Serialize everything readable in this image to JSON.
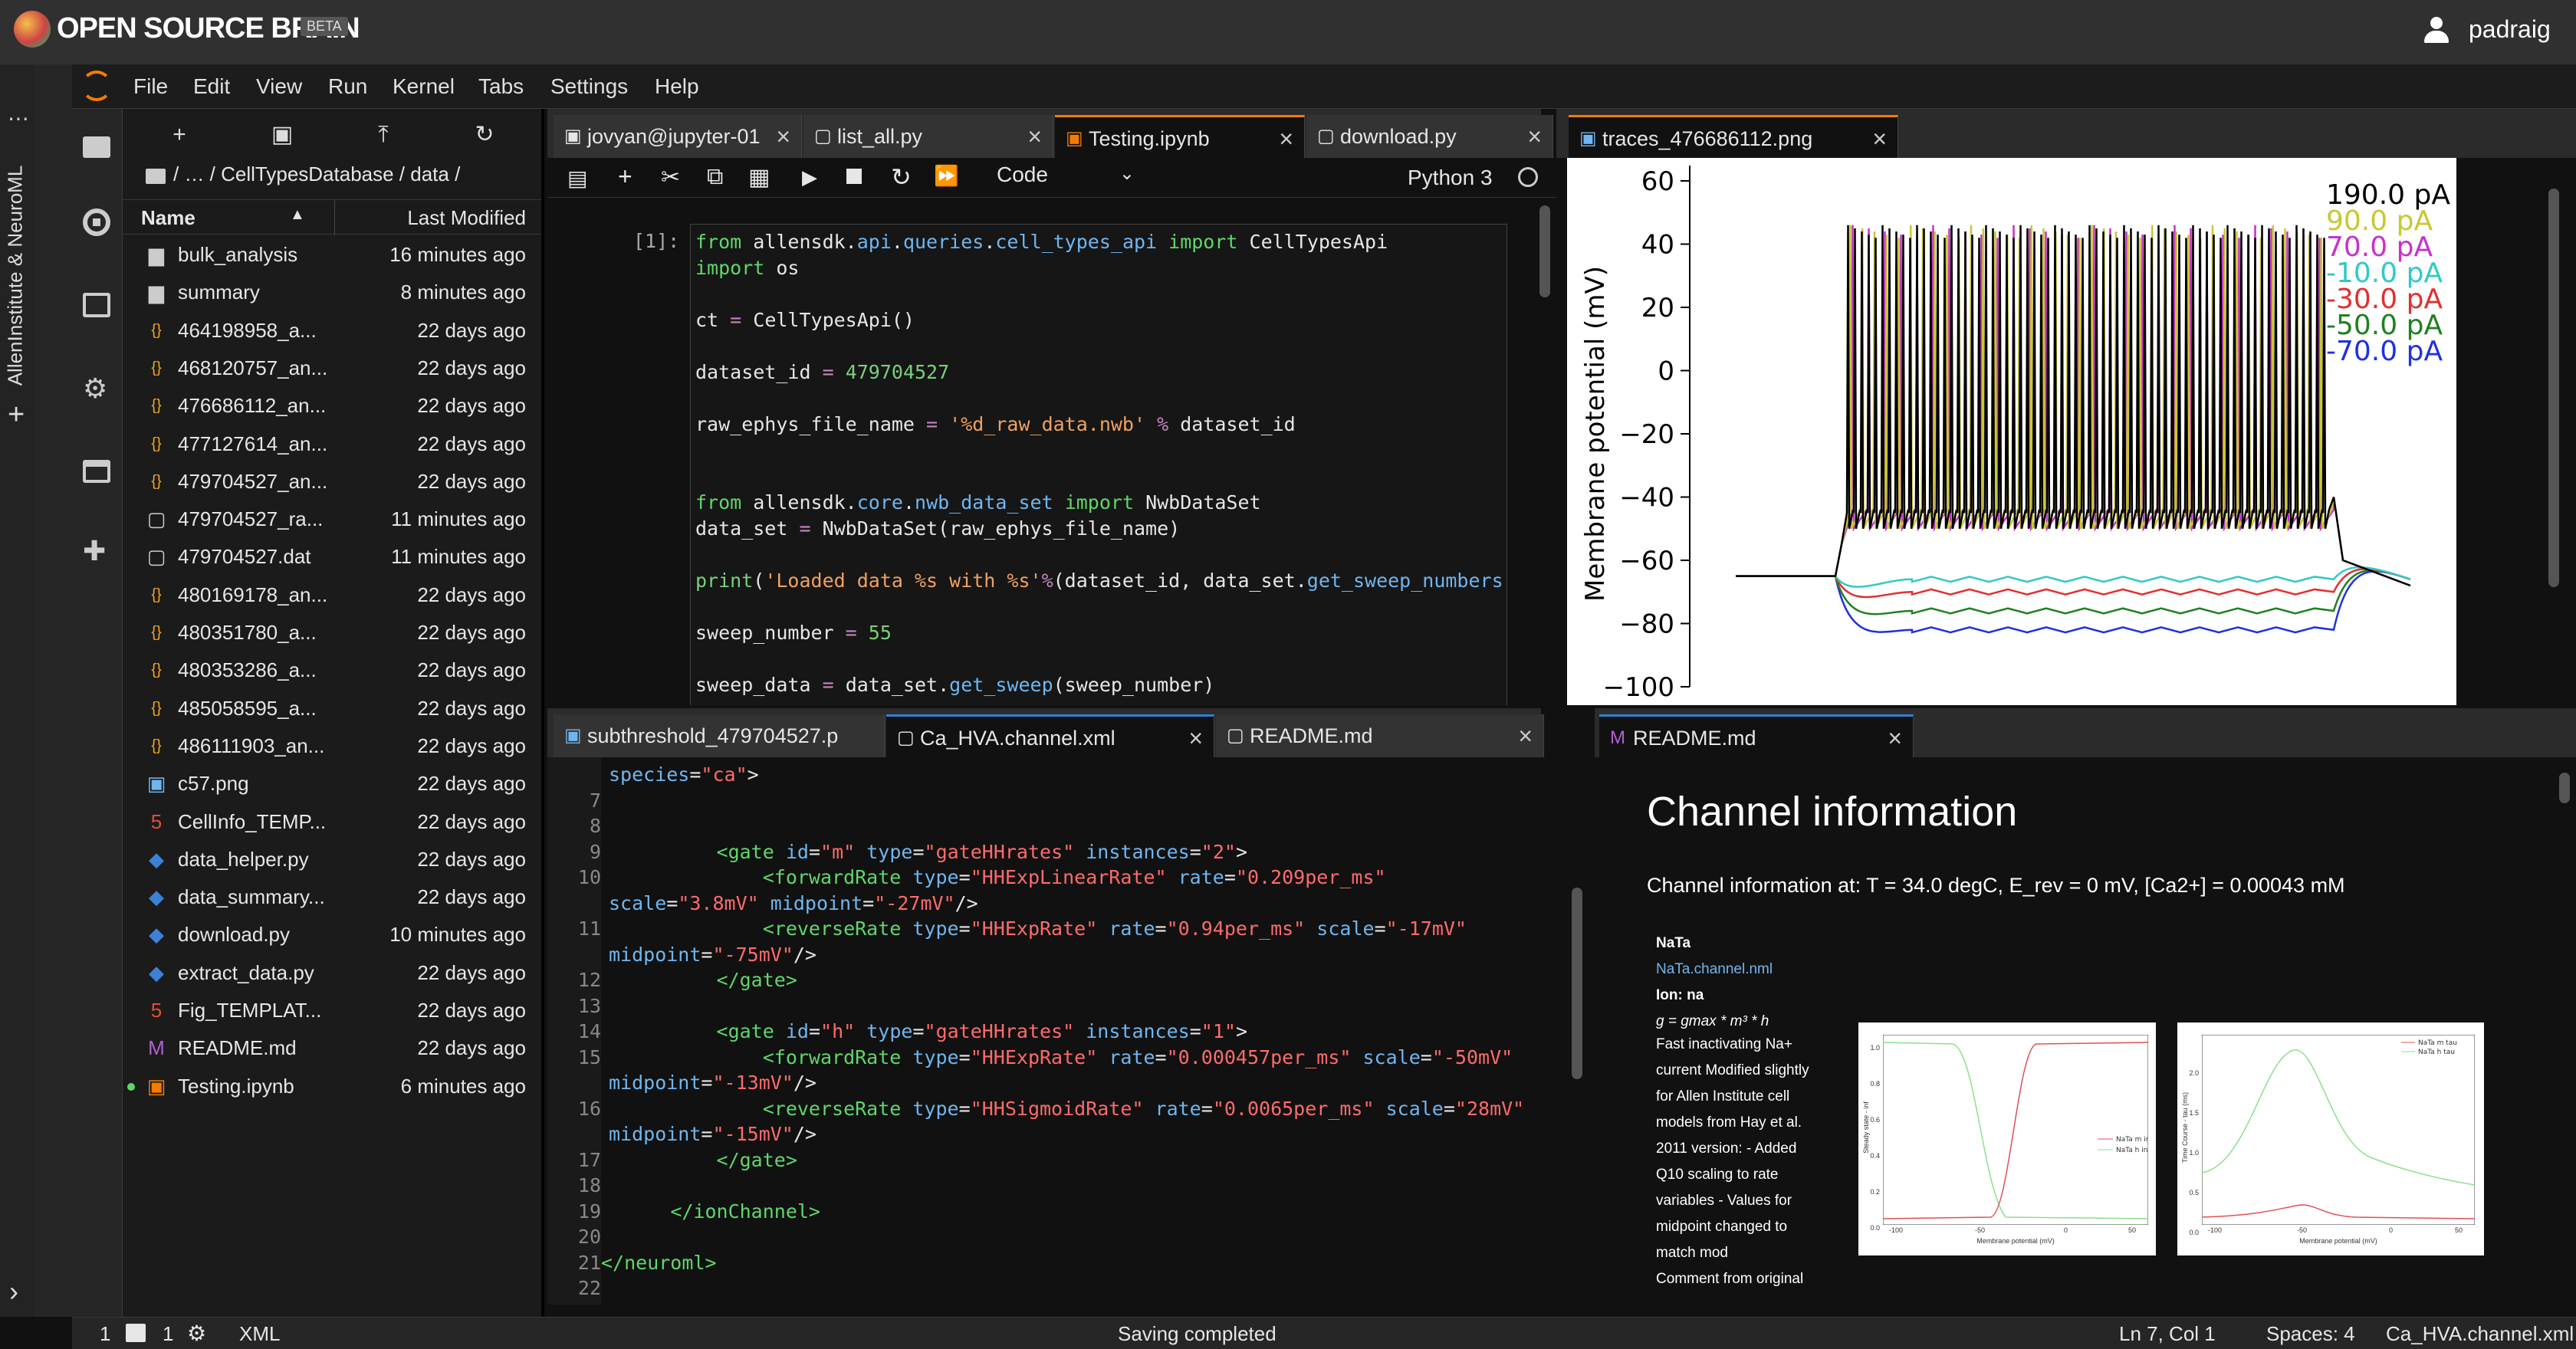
{
  "brand": {
    "name": "OPEN SOURCE BRAIN",
    "badge": "BETA",
    "user": "padraig"
  },
  "menu": [
    "File",
    "Edit",
    "View",
    "Run",
    "Kernel",
    "Tabs",
    "Settings",
    "Help"
  ],
  "side_label": "AllenInstitute & NeuroML",
  "files": {
    "path": "/ … / CellTypesDatabase / data /",
    "col_name": "Name",
    "col_modified": "Last Modified",
    "rows": [
      {
        "name": "bulk_analysis",
        "mod": "16 minutes ago",
        "icon": "folder-icon"
      },
      {
        "name": "summary",
        "mod": "8 minutes ago",
        "icon": "folder-icon"
      },
      {
        "name": "464198958_a...",
        "mod": "22 days ago",
        "icon": "json-file-icon"
      },
      {
        "name": "468120757_an...",
        "mod": "22 days ago",
        "icon": "json-file-icon"
      },
      {
        "name": "476686112_an...",
        "mod": "22 days ago",
        "icon": "json-file-icon"
      },
      {
        "name": "477127614_an...",
        "mod": "22 days ago",
        "icon": "json-file-icon"
      },
      {
        "name": "479704527_an...",
        "mod": "22 days ago",
        "icon": "json-file-icon"
      },
      {
        "name": "479704527_ra...",
        "mod": "11 minutes ago",
        "icon": "file-icon"
      },
      {
        "name": "479704527.dat",
        "mod": "11 minutes ago",
        "icon": "file-icon"
      },
      {
        "name": "480169178_an...",
        "mod": "22 days ago",
        "icon": "json-file-icon"
      },
      {
        "name": "480351780_a...",
        "mod": "22 days ago",
        "icon": "json-file-icon"
      },
      {
        "name": "480353286_a...",
        "mod": "22 days ago",
        "icon": "json-file-icon"
      },
      {
        "name": "485058595_a...",
        "mod": "22 days ago",
        "icon": "json-file-icon"
      },
      {
        "name": "486111903_an...",
        "mod": "22 days ago",
        "icon": "json-file-icon"
      },
      {
        "name": "c57.png",
        "mod": "22 days ago",
        "icon": "image-file-icon"
      },
      {
        "name": "CellInfo_TEMP...",
        "mod": "22 days ago",
        "icon": "html-file-icon"
      },
      {
        "name": "data_helper.py",
        "mod": "22 days ago",
        "icon": "python-file-icon"
      },
      {
        "name": "data_summary...",
        "mod": "22 days ago",
        "icon": "python-file-icon"
      },
      {
        "name": "download.py",
        "mod": "10 minutes ago",
        "icon": "python-file-icon"
      },
      {
        "name": "extract_data.py",
        "mod": "22 days ago",
        "icon": "python-file-icon"
      },
      {
        "name": "Fig_TEMPLAT...",
        "mod": "22 days ago",
        "icon": "html-file-icon"
      },
      {
        "name": "README.md",
        "mod": "22 days ago",
        "icon": "markdown-file-icon"
      },
      {
        "name": "Testing.ipynb",
        "mod": "6 minutes ago",
        "icon": "notebook-file-icon"
      }
    ]
  },
  "top_tabs": [
    "jovyan@jupyter-01",
    "list_all.py",
    "Testing.ipynb",
    "download.py"
  ],
  "notebook": {
    "cell_type": "Code",
    "kernel": "Python 3",
    "prompt": "[1]:"
  },
  "image_tab": "traces_476686112.png",
  "chart_data": {
    "type": "line",
    "ylabel": "Membrane potential (mV)",
    "yticks": [
      60,
      40,
      20,
      0,
      -20,
      -40,
      -60,
      -80,
      -100
    ],
    "ylim": [
      -100,
      60
    ],
    "series": [
      {
        "name": "190.0 pA",
        "color": "#000000",
        "steady": -62,
        "spikes": true
      },
      {
        "name": "90.0 pA",
        "color": "#c8c832",
        "steady": -60,
        "spikes": true
      },
      {
        "name": "70.0 pA",
        "color": "#c832c8",
        "steady": -62,
        "spikes": true
      },
      {
        "name": "-10.0 pA",
        "color": "#32c8c8",
        "steady": -66,
        "spikes": false
      },
      {
        "name": "-30.0 pA",
        "color": "#e03030",
        "steady": -70,
        "spikes": false
      },
      {
        "name": "-50.0 pA",
        "color": "#208020",
        "steady": -76,
        "spikes": false
      },
      {
        "name": "-70.0 pA",
        "color": "#2030e0",
        "steady": -82,
        "spikes": false
      }
    ]
  },
  "bottom_tabs": [
    "subthreshold_479704527.p",
    "Ca_HVA.channel.xml",
    "README.md"
  ],
  "readme_tab": "README.md",
  "readme": {
    "title": "Channel information",
    "subtitle": "Channel information at: T = 34.0 degC, E_rev = 0 mV, [Ca2+] = 0.00043 mM",
    "ch_name": "NaTa",
    "ch_link": "NaTa.channel.nml",
    "ion": "Ion: na",
    "eq": "g = gmax * m³ * h",
    "desc": [
      "Fast inactivating Na+",
      "current Modified slightly",
      "for Allen Institute cell",
      "models from Hay et al.",
      "2011 version: - Added",
      "Q10 scaling to rate",
      "variables - Values for",
      "midpoint changed to",
      "match mod",
      "Comment from original"
    ],
    "plot1_legend": [
      "NaTa m inf",
      "NaTa h inf"
    ],
    "plot2_legend": [
      "NaTa m tau",
      "NaTa h tau"
    ],
    "plot_xlabel": "Membrane potential (mV)",
    "plot1_ylabel": "Steady state - inf",
    "plot2_ylabel": "Time Course - tau (ms)",
    "plot1_yticks": [
      "1.0",
      "0.8",
      "0.6",
      "0.4",
      "0.2",
      "0.0"
    ],
    "plot2_yticks": [
      "2.0",
      "1.5",
      "1.0",
      "0.5",
      "0.0"
    ],
    "plot_xticks": [
      "-100",
      "-50",
      "0",
      "50"
    ]
  },
  "status": {
    "left1": "1",
    "left2": "1",
    "mode": "XML",
    "center": "Saving completed",
    "pos": "Ln 7, Col 1",
    "spaces": "Spaces: 4",
    "file": "Ca_HVA.channel.xml"
  }
}
